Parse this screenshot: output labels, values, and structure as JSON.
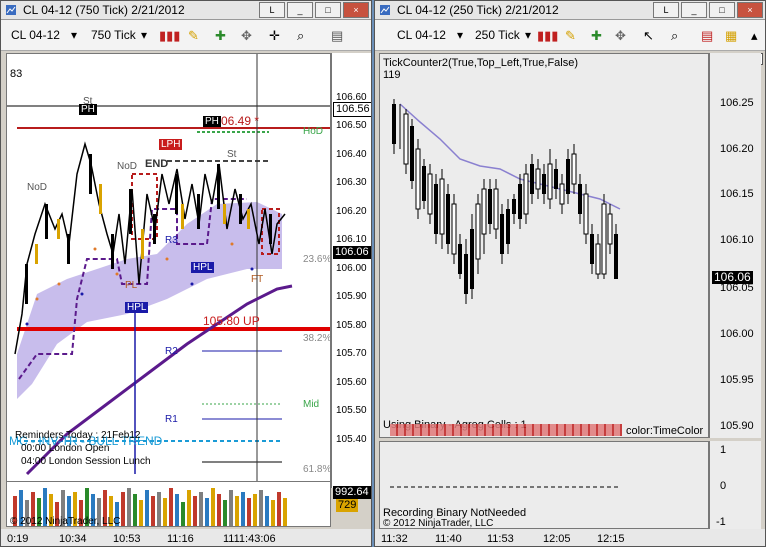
{
  "left_window": {
    "title": "CL 04-12 (750 Tick)  2/21/2012",
    "instrument": "CL 04-12",
    "period": "750 Tick",
    "counter": "83",
    "price_ticks": [
      "106.60",
      "106.50",
      "106.40",
      "106.30",
      "106.20",
      "106.10",
      "106.00",
      "105.90",
      "105.80",
      "105.70",
      "105.60",
      "105.50",
      "105.40"
    ],
    "level_boxes": [
      "106.56",
      "106.06"
    ],
    "current_price": "106.06",
    "time_labels": [
      "0:19",
      "10:34",
      "10:53",
      "11:16",
      "1111:43:06"
    ],
    "labels": {
      "ph1": "PH",
      "ph2": "PH",
      "ph_value": "06.49 *",
      "hod": "HoD",
      "lph": "LPH",
      "end": "END",
      "nod1": "NoD",
      "nod2": "NoD",
      "st1": "St",
      "st2": "St",
      "r3": "R3",
      "r2": "R2",
      "r1": "R1",
      "hpl1": "HPL",
      "hpl2": "HPL",
      "pl": "PL",
      "ft": "FT",
      "up_level": "105.80 UP",
      "mid": "Mid",
      "fib1": "23.6%",
      "fib2": "38.2%",
      "fib3": "61.8%",
      "bull_trend": "MC - INV-TR - BULL TREND",
      "reminders": "Reminders Today : 21Feb12",
      "reminder1": "00:00 London Open",
      "reminder2": "04:00 London Session Lunch"
    },
    "volume_box1": "992.64",
    "volume_box2": "729",
    "copyright": "© 2012 NinjaTrader, LLC"
  },
  "right_window": {
    "title": "CL 04-12 (250 Tick)  2/21/2012",
    "instrument": "CL 04-12",
    "period": "250 Tick",
    "indicator": "TickCounter2(True,Top_Left,True,False)",
    "counter": "119",
    "price_ticks": [
      "106.25",
      "106.20",
      "106.15",
      "106.10",
      "106.05",
      "106.00",
      "105.95",
      "105.90"
    ],
    "current_price": "106.06",
    "binary_label": "Using Binary - Agreg Cells : 1",
    "time_color": "color:TimeColor",
    "lower_ticks": [
      "1",
      "0",
      "-1"
    ],
    "recording": "Recording Binary NotNeeded",
    "copyright": "© 2012 NinjaTrader, LLC",
    "time_labels": [
      "11:32",
      "11:40",
      "11:53",
      "12:05",
      "12:15"
    ]
  },
  "window_buttons": {
    "help": "L",
    "min": "_",
    "max": "□",
    "close": "×"
  },
  "colors": {
    "up_line": "#e00000",
    "bull_trend": "#1a9bd6",
    "ma_purple": "#5b1a8c",
    "cloud": "#b5a7e6",
    "hpl_box": "#1a1aa8"
  }
}
